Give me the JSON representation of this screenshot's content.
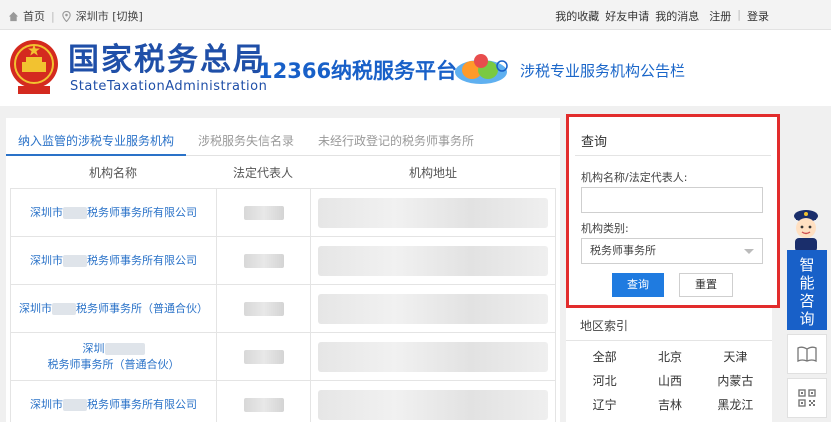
{
  "topbar": {
    "home": "首页",
    "city": "深圳市 [切换]",
    "links": [
      "我的收藏",
      "好友申请",
      "我的消息",
      "注册",
      "登录"
    ]
  },
  "header": {
    "brand_cn": "国家税务总局",
    "brand_en": "StateTaxationAdministration",
    "platform": "12366纳税服务平台",
    "board_title": "涉税专业服务机构公告栏"
  },
  "tabs": [
    "纳入监管的涉税专业服务机构",
    "涉税服务失信名录",
    "未经行政登记的税务师事务所"
  ],
  "active_tab": 0,
  "table": {
    "headers": [
      "机构名称",
      "法定代表人",
      "机构地址"
    ],
    "rows": [
      {
        "prefix": "深圳市",
        "suffix": "税务师事务所有限公司"
      },
      {
        "prefix": "深圳市",
        "suffix": "税务师事务所有限公司"
      },
      {
        "prefix": "深圳市",
        "suffix": "税务师事务所（普通合伙）"
      },
      {
        "prefix": "深圳",
        "suffix": "税务师事务所（普通合伙）"
      },
      {
        "prefix": "深圳市",
        "suffix": "税务师事务所有限公司"
      }
    ]
  },
  "query": {
    "title": "查询",
    "name_label": "机构名称/法定代表人:",
    "name_value": "",
    "type_label": "机构类别:",
    "type_value": "税务师事务所",
    "search_btn": "查询",
    "reset_btn": "重置"
  },
  "region": {
    "title": "地区索引",
    "items": [
      "全部",
      "北京",
      "天津",
      "河北",
      "山西",
      "内蒙古",
      "辽宁",
      "吉林",
      "黑龙江"
    ]
  },
  "side": {
    "ai_label": "智能咨询"
  },
  "colors": {
    "brand_blue": "#1f4fa8",
    "link_blue": "#2a72c8",
    "button_blue": "#1f7be0",
    "highlight_red": "#e22c2c"
  }
}
